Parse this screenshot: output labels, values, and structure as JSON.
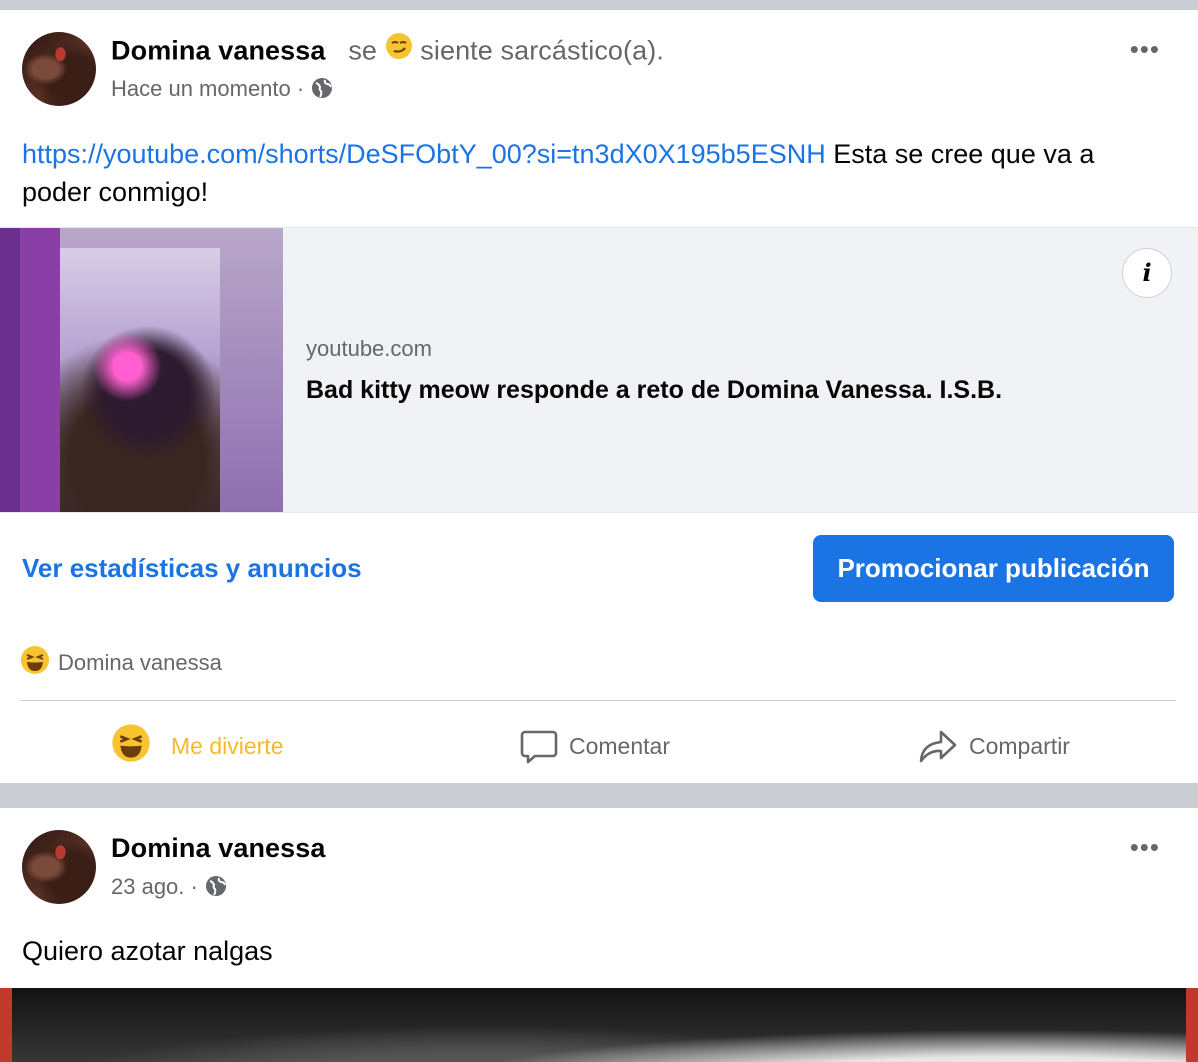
{
  "post1": {
    "author": "Domina vanessa",
    "feeling_prefix": "se",
    "feeling_text": "siente sarcástico(a).",
    "timestamp": "Hace un momento",
    "privacy_icon": "globe-icon",
    "more_label": "•••",
    "link_url": "https://youtube.com/shorts/DeSFObtY_00?si=tn3dX0X195b5ESNH",
    "body_text": " Esta se cree que va a poder conmigo!",
    "link_card": {
      "domain": "youtube.com",
      "title": "Bad kitty meow responde a reto de Domina Vanessa. I.S.B.",
      "info_label": "i"
    },
    "stats_link": "Ver estadísticas y anuncios",
    "promote_button": "Promocionar publicación",
    "reactions": {
      "icon": "haha-emoji-icon",
      "names": "Domina vanessa"
    },
    "actions": {
      "like": "Me divierte",
      "comment": "Comentar",
      "share": "Compartir"
    },
    "colors": {
      "accent": "#1b74e4",
      "reaction": "#f7b928",
      "muted": "#65676b"
    }
  },
  "post2": {
    "author": "Domina vanessa",
    "timestamp": "23 ago.",
    "privacy_icon": "globe-icon",
    "more_label": "•••",
    "body_text": "Quiero azotar nalgas"
  }
}
